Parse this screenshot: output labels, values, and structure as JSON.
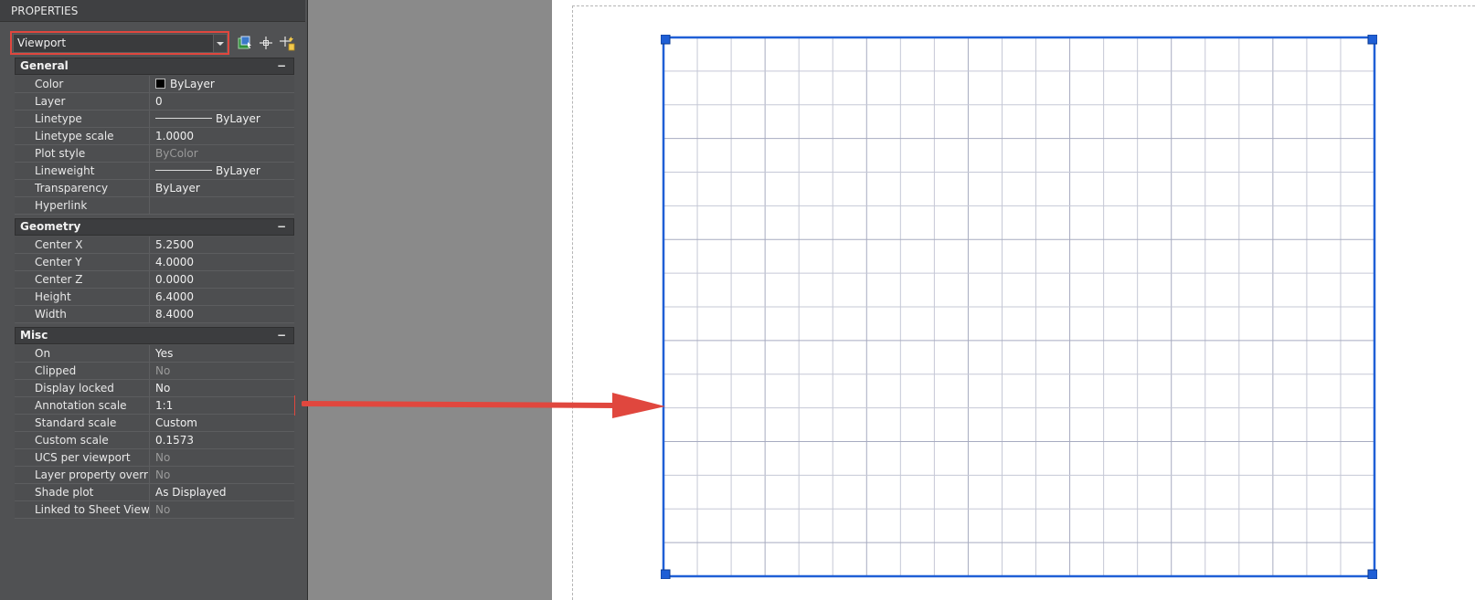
{
  "palette": {
    "title": "PROPERTIES",
    "object_type": "Viewport",
    "tools": [
      "select-objects-icon",
      "pick-add-icon",
      "quick-select-icon"
    ],
    "sections": [
      {
        "title": "General",
        "collapse_symbol": "−",
        "rows": [
          {
            "name": "Color",
            "value": "ByLayer",
            "decor": "swatch"
          },
          {
            "name": "Layer",
            "value": "0"
          },
          {
            "name": "Linetype",
            "value": "ByLayer",
            "decor": "line"
          },
          {
            "name": "Linetype scale",
            "value": "1.0000"
          },
          {
            "name": "Plot style",
            "value": "ByColor",
            "dim": true
          },
          {
            "name": "Lineweight",
            "value": "ByLayer",
            "decor": "line"
          },
          {
            "name": "Transparency",
            "value": "ByLayer"
          },
          {
            "name": "Hyperlink",
            "value": ""
          }
        ]
      },
      {
        "title": "Geometry",
        "collapse_symbol": "−",
        "rows": [
          {
            "name": "Center X",
            "value": "5.2500"
          },
          {
            "name": "Center Y",
            "value": "4.0000"
          },
          {
            "name": "Center Z",
            "value": "0.0000"
          },
          {
            "name": "Height",
            "value": "6.4000"
          },
          {
            "name": "Width",
            "value": "8.4000"
          }
        ]
      },
      {
        "title": "Misc",
        "collapse_symbol": "−",
        "rows": [
          {
            "name": "On",
            "value": "Yes"
          },
          {
            "name": "Clipped",
            "value": "No",
            "dim": true
          },
          {
            "name": "Display locked",
            "value": "No"
          },
          {
            "name": "Annotation scale",
            "value": "1:1",
            "highlight": true
          },
          {
            "name": "Standard scale",
            "value": "Custom"
          },
          {
            "name": "Custom scale",
            "value": "0.1573"
          },
          {
            "name": "UCS per viewport",
            "value": "No",
            "dim": true
          },
          {
            "name": "Layer property overri...",
            "value": "No",
            "dim": true
          },
          {
            "name": "Shade plot",
            "value": "As Displayed"
          },
          {
            "name": "Linked to Sheet View",
            "value": "No",
            "dim": true
          }
        ]
      }
    ]
  },
  "viewport": {
    "grid_columns": 21,
    "grid_rows": 16,
    "major_every": 3,
    "frame_color": "#1f5fd6",
    "grid_color": "#c5c8d6",
    "major_grid_color": "#a7abc0"
  },
  "colors": {
    "highlight": "#e0473e",
    "arrow": "#e0473e"
  }
}
